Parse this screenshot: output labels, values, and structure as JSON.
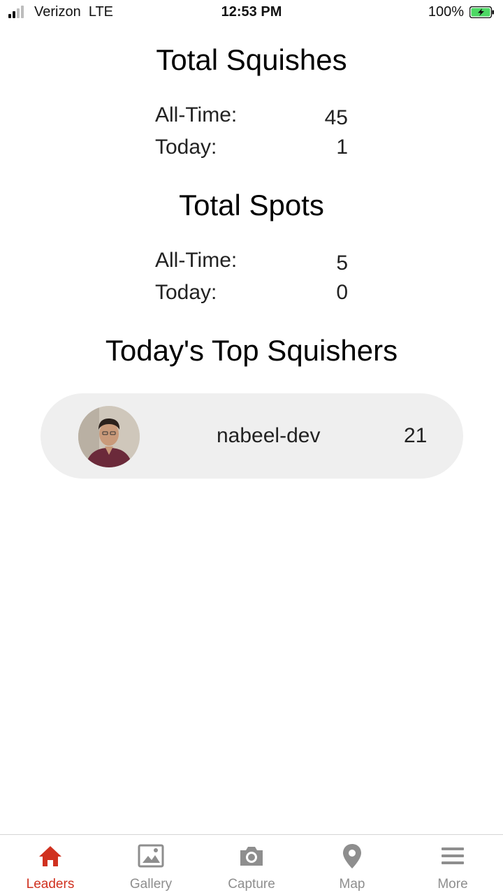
{
  "status_bar": {
    "carrier": "Verizon  LTE",
    "time": "12:53 PM",
    "battery": "100%"
  },
  "squishes": {
    "title": "Total Squishes",
    "all_time_label": "All-Time:",
    "all_time_value": "45",
    "today_label": "Today:",
    "today_value": "1"
  },
  "spots": {
    "title": "Total Spots",
    "all_time_label": "All-Time:",
    "all_time_value": "5",
    "today_label": "Today:",
    "today_value": "0"
  },
  "top_squishers": {
    "title": "Today's Top Squishers",
    "leaders": [
      {
        "name": "nabeel-dev",
        "score": "21",
        "avatar": "user-avatar-photo"
      }
    ]
  },
  "tabs": [
    {
      "label": "Leaders",
      "icon": "house-icon",
      "active": true
    },
    {
      "label": "Gallery",
      "icon": "image-icon",
      "active": false
    },
    {
      "label": "Capture",
      "icon": "camera-icon",
      "active": false
    },
    {
      "label": "Map",
      "icon": "map-pin-icon",
      "active": false
    },
    {
      "label": "More",
      "icon": "menu-icon",
      "active": false
    }
  ],
  "colors": {
    "accent": "#d0311f",
    "inactive_tab": "#8e8e8e",
    "card_background": "#efefef",
    "battery_fill": "#4cd964"
  }
}
